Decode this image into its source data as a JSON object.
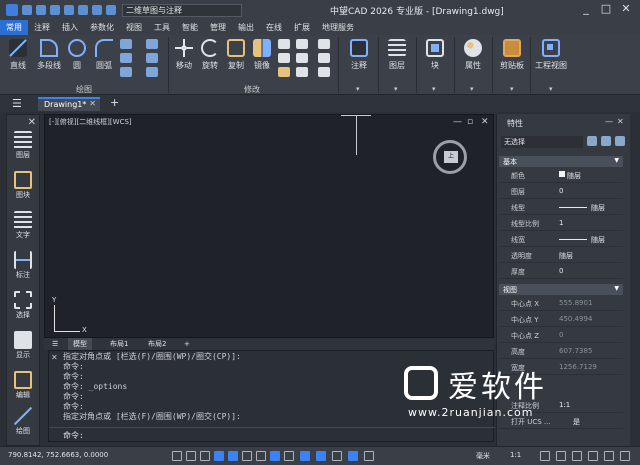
{
  "app": {
    "title": "中望CAD 2026 专业版 - [Drawing1.dwg]",
    "workspace": "二维草图与注释",
    "window_controls": [
      "_",
      "□",
      "✕"
    ]
  },
  "menubar": {
    "items": [
      "常用",
      "注释",
      "插入",
      "参数化",
      "视图",
      "工具",
      "智能",
      "管理",
      "输出",
      "在线",
      "扩展",
      "地理服务"
    ],
    "active": "常用"
  },
  "ribbon": {
    "draw": {
      "line": "直线",
      "polyline": "多段线",
      "circle": "圆",
      "arc": "圆弧",
      "group_label": "绘图"
    },
    "modify": {
      "move": "移动",
      "rotate": "旋转",
      "copy": "复制",
      "mirror": "镜像",
      "group_label": "修改"
    },
    "panels": {
      "annotate": "注释",
      "layer": "图层",
      "block": "块",
      "properties": "属性",
      "clipboard": "剪贴板",
      "view": "工程视图"
    }
  },
  "tabs": {
    "document": "Drawing1*",
    "new_tab": "+"
  },
  "lefttools": {
    "items": [
      "图层",
      "图块",
      "文字",
      "标注",
      "选择",
      "显示",
      "编辑",
      "绘图"
    ]
  },
  "canvas": {
    "view_label": "[-][俯视][二维线框][WCS]",
    "view_controls": [
      "—",
      "▫",
      "✕"
    ],
    "viewcube_face": "上",
    "ucs_y": "Y",
    "ucs_x": "X"
  },
  "layout_tabs": [
    "模型",
    "布局1",
    "布局2",
    "+"
  ],
  "command": {
    "lines": [
      "指定对角点或 [栏选(F)/圈围(WP)/圈交(CP)]:",
      "命令:",
      "命令:",
      "命令: _options",
      "命令:",
      "命令:",
      "指定对角点或 [栏选(F)/圈围(WP)/圈交(CP)]:"
    ],
    "prompt": "命令:"
  },
  "properties": {
    "title": "特性",
    "selection": "无选择",
    "sections": {
      "basic": "基本",
      "view": "视图"
    },
    "basic_rows": [
      {
        "key": "颜色",
        "value": "随层"
      },
      {
        "key": "图层",
        "value": "0"
      },
      {
        "key": "线型",
        "value": "随层"
      },
      {
        "key": "线型比例",
        "value": "1"
      },
      {
        "key": "线宽",
        "value": "随层"
      },
      {
        "key": "透明度",
        "value": "随层"
      },
      {
        "key": "厚度",
        "value": "0"
      }
    ],
    "view_rows": [
      {
        "key": "中心点 X",
        "value": "555.8901"
      },
      {
        "key": "中心点 Y",
        "value": "450.4994"
      },
      {
        "key": "中心点 Z",
        "value": "0"
      },
      {
        "key": "高度",
        "value": "607.7385"
      },
      {
        "key": "宽度",
        "value": "1256.7129"
      }
    ],
    "extra_rows": [
      {
        "key": "注释比例",
        "value": "1:1"
      },
      {
        "key": "打开 UCS ...",
        "value": "是"
      }
    ]
  },
  "statusbar": {
    "coords": "790.8142, 752.6663, 0.0000",
    "unit": "毫米",
    "scale": "1:1"
  },
  "watermark": {
    "brand": "爱软件",
    "url": "www.2ruanjian.com"
  },
  "colors": {
    "accent": "#3b82f6",
    "canvas_bg": "#1f2329"
  }
}
